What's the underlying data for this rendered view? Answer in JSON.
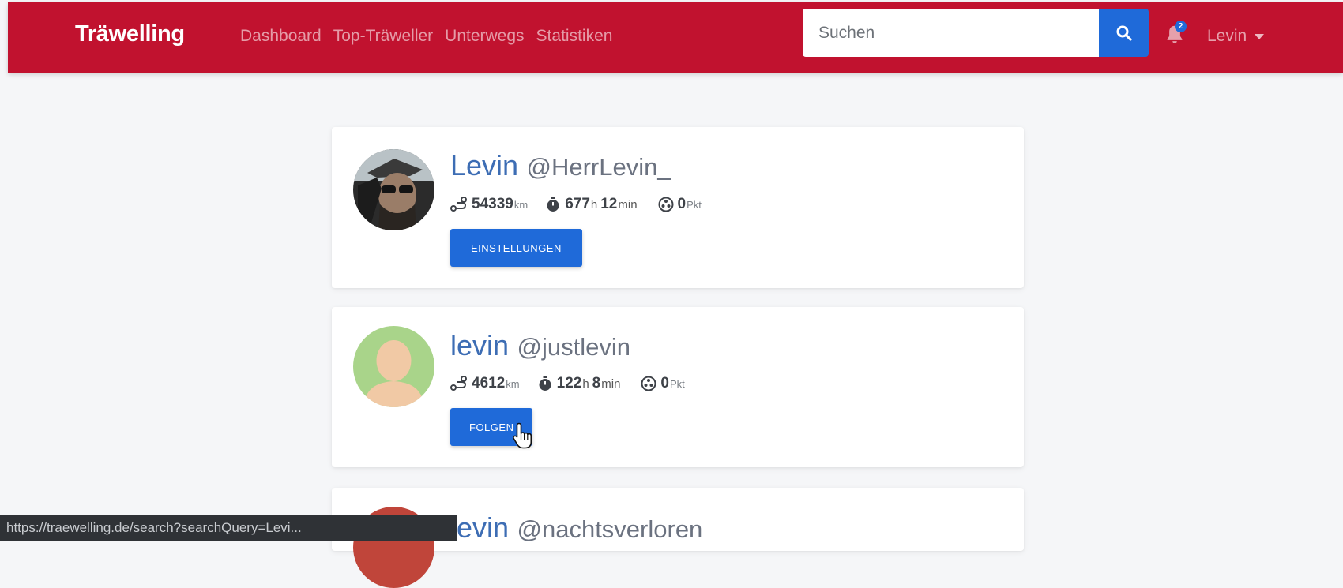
{
  "navbar": {
    "brand": "Träwelling",
    "links": [
      "Dashboard",
      "Top-Träweller",
      "Unterwegs",
      "Statistiken"
    ],
    "search": {
      "placeholder": "Suchen",
      "value": ""
    },
    "notifications": {
      "count": "2",
      "icon": "bell-icon"
    },
    "user_menu_label": "Levin",
    "accent_color": "#c1122f",
    "button_color": "#1f6ad9"
  },
  "results": [
    {
      "display_name": "Levin",
      "username": "@HerrLevin_",
      "distance": "54339",
      "distance_unit": "km",
      "hours": "677",
      "hours_unit": "h",
      "minutes": "12",
      "minutes_unit": "min",
      "points": "0",
      "points_unit": "Pkt",
      "button_label": "EINSTELLUNGEN"
    },
    {
      "display_name": "levin",
      "username": "@justlevin",
      "distance": "4612",
      "distance_unit": "km",
      "hours": "122",
      "hours_unit": "h",
      "minutes": "8",
      "minutes_unit": "min",
      "points": "0",
      "points_unit": "Pkt",
      "button_label": "FOLGEN"
    },
    {
      "display_name": "levin",
      "username": "@nachtsverloren"
    }
  ],
  "status_bar": {
    "url": "https://traewelling.de/search?searchQuery=Levi..."
  }
}
